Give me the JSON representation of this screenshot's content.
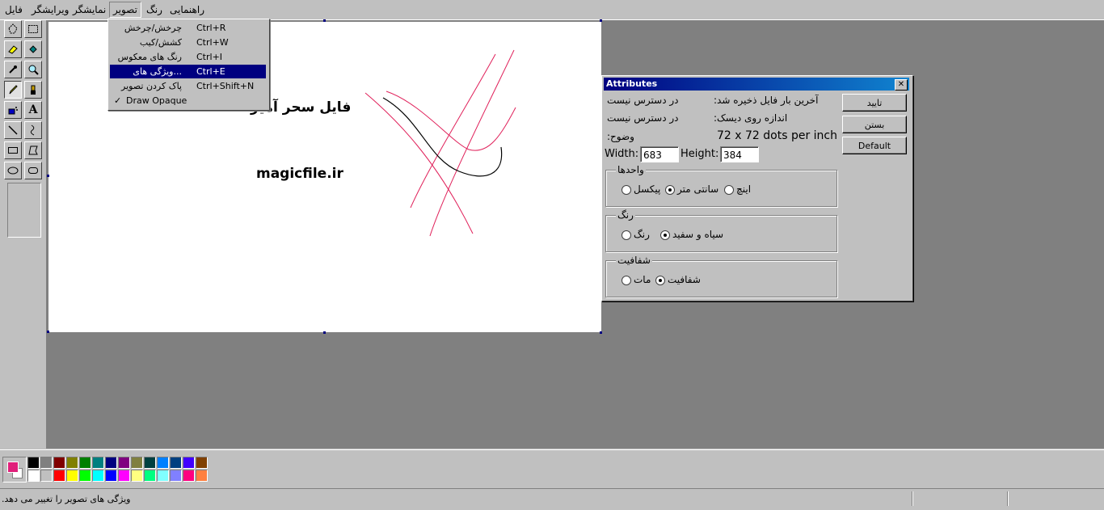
{
  "menubar": {
    "items": [
      "فایل",
      "ویرایشگر",
      "نمایشگر",
      "تصویر",
      "رنگ",
      "راهنمایی"
    ],
    "open_index": 3
  },
  "image_menu": {
    "items": [
      {
        "label": "چرخش/چرخش",
        "shortcut": "Ctrl+R"
      },
      {
        "label": "کشش/کیب",
        "shortcut": "Ctrl+W"
      },
      {
        "label": "رنگ های معکوس",
        "shortcut": "Ctrl+I"
      },
      {
        "label": "...ویژگی های",
        "shortcut": "Ctrl+E"
      },
      {
        "label": "پاک کردن تصویر",
        "shortcut": "Ctrl+Shift+N"
      },
      {
        "label": "Draw Opaque",
        "shortcut": "",
        "checked": "✓"
      }
    ],
    "selected_index": 3
  },
  "canvas": {
    "title_text": "فایل سحر آمیز",
    "url_text": "magicfile.ir",
    "red_stroke": "#e0205a",
    "black_stroke": "#000000"
  },
  "toolbox": {
    "tools": [
      "free-select",
      "rect-select",
      "eraser",
      "fill",
      "color-picker",
      "magnifier",
      "pencil",
      "brush",
      "airbrush",
      "text",
      "line",
      "curve",
      "rectangle",
      "polygon",
      "ellipse",
      "rounded-rectangle"
    ],
    "active_tool": "pencil"
  },
  "palette": {
    "foreground": "#e0207a",
    "background": "#ffffff",
    "row1": [
      "#000000",
      "#808080",
      "#800000",
      "#808000",
      "#008000",
      "#008080",
      "#000080",
      "#800080",
      "#808040",
      "#004040",
      "#0080ff",
      "#004080",
      "#4000ff",
      "#804000"
    ],
    "row2": [
      "#ffffff",
      "#c0c0c0",
      "#ff0000",
      "#ffff00",
      "#00ff00",
      "#00ffff",
      "#0000ff",
      "#ff00ff",
      "#ffff80",
      "#00ff80",
      "#80ffff",
      "#8080ff",
      "#ff0080",
      "#ff8040"
    ]
  },
  "dialog": {
    "title": "Attributes",
    "last_saved_label": "آخرین بار فایل ذخیره شد:",
    "last_saved_value": "در دسترس نیست",
    "disk_size_label": "اندازه روی دیسک:",
    "disk_size_value": "در دسترس نیست",
    "resolution_label": "وضوح:",
    "resolution_value": "72 x 72 dots per inch",
    "width_label": "Width:",
    "width_value": "683",
    "height_label": "Height:",
    "height_value": "384",
    "ok_label": "تایید",
    "cancel_label": "بستن",
    "default_label": "Default",
    "units": {
      "title": "واحدها",
      "inches": "اینچ",
      "cm": "سانتی متر",
      "pixels": "پیکسل",
      "selected": "cm"
    },
    "colors": {
      "title": "رنگ",
      "bw": "سیاه و سفید",
      "colors": "رنگ",
      "selected": "bw"
    },
    "transparency": {
      "title": "شفافیت",
      "transparent": "شفافیت",
      "opaque": "مات",
      "selected": "transparent"
    }
  },
  "statusbar": {
    "text": "ویژگی های تصویر را تغییر می دهد."
  }
}
